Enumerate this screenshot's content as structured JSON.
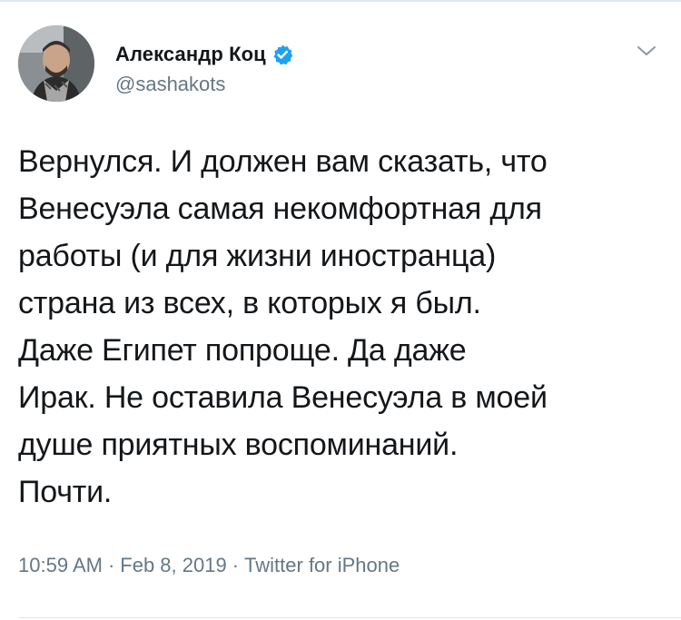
{
  "author": {
    "display_name": "Александр Коц",
    "handle": "@sashakots",
    "verified": true,
    "avatar_icon": "profile-photo",
    "verified_icon": "verified-badge-icon",
    "menu_icon": "chevron-down-icon"
  },
  "tweet": {
    "lines": [
      "Вернулся. И должен вам сказать, что",
      "Венесуэла самая некомфортная для",
      "работы (и для жизни иностранца)",
      "страна из всех, в которых я был.",
      "Даже Египет попроще. Да даже",
      "Ирак. Не оставила Венесуэла в моей",
      "душе приятных воспоминаний.",
      "Почти."
    ]
  },
  "meta": {
    "time": "10:59 AM",
    "separator": "·",
    "date": "Feb 8, 2019",
    "source": "Twitter for iPhone"
  },
  "colors": {
    "text": "#14171a",
    "secondary": "#657786",
    "verified": "#1da1f2",
    "border": "#e1e8ed"
  }
}
